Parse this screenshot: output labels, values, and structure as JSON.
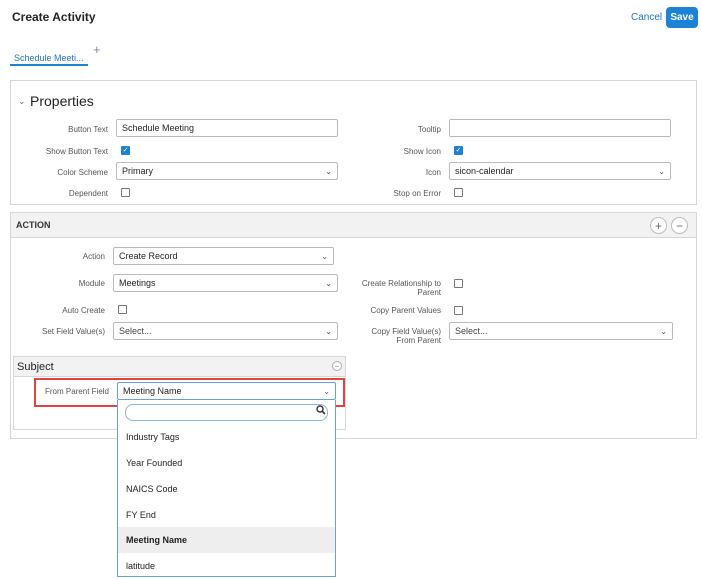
{
  "header": {
    "title": "Create Activity",
    "cancel_label": "Cancel",
    "save_label": "Save"
  },
  "tabs": [
    {
      "label": "Schedule Meeti..."
    }
  ],
  "add_tab_glyph": "+",
  "properties": {
    "title": "Properties",
    "button_text_label": "Button Text",
    "button_text_value": "Schedule Meeting",
    "show_button_text_label": "Show Button Text",
    "show_button_text_checked": true,
    "color_scheme_label": "Color Scheme",
    "color_scheme_value": "Primary",
    "dependent_label": "Dependent",
    "dependent_checked": false,
    "tooltip_label": "Tooltip",
    "tooltip_value": "",
    "show_icon_label": "Show Icon",
    "show_icon_checked": true,
    "icon_label": "Icon",
    "icon_value": "sicon-calendar",
    "stop_on_error_label": "Stop on Error",
    "stop_on_error_checked": false
  },
  "action": {
    "title": "ACTION",
    "add_glyph": "+",
    "remove_glyph": "−",
    "action_label": "Action",
    "action_value": "Create Record",
    "module_label": "Module",
    "module_value": "Meetings",
    "auto_create_label": "Auto Create",
    "set_field_values_label": "Set Field Value(s)",
    "set_field_values_placeholder": "Select...",
    "create_relationship_label_1": "Create Relationship to",
    "create_relationship_label_2": "Parent",
    "copy_parent_values_label": "Copy Parent Values",
    "copy_field_values_label_1": "Copy Field Value(s)",
    "copy_field_values_label_2": "From Parent",
    "copy_field_values_placeholder": "Select..."
  },
  "subject": {
    "title": "Subject",
    "from_parent_field_label": "From Parent Field",
    "from_parent_field_value": "Meeting Name",
    "dropdown_options": [
      "Industry Tags",
      "Year Founded",
      "NAICS Code",
      "FY End",
      "Meeting Name",
      "latitude"
    ],
    "selected_option": "Meeting Name"
  },
  "icons": {
    "caret": "⌄",
    "check": "✓",
    "search": "🔍",
    "chevron_down": "⌄"
  },
  "colors": {
    "accent": "#1c82d6",
    "highlight": "#e0443e"
  }
}
